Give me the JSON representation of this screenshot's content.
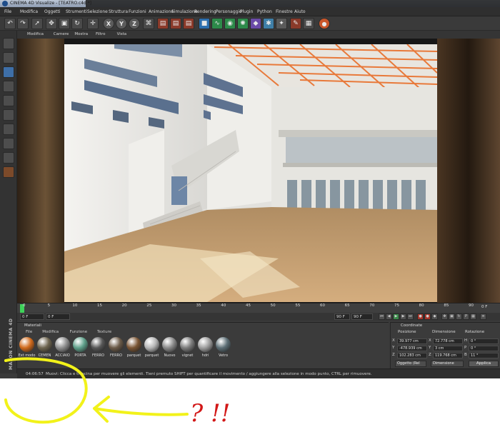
{
  "window": {
    "title": "CINEMA 4D Visualize - [TEATRO.c4d *]"
  },
  "menubar": {
    "items": [
      "File",
      "Modifica",
      "Oggetti",
      "Strumenti",
      "Selezione",
      "Struttura",
      "Funzioni",
      "Animazione",
      "Simulazione",
      "Rendering",
      "Personaggio",
      "Plugin",
      "Python",
      "Finestre",
      "Aiuto"
    ]
  },
  "toolbar": {
    "axis_x": "X",
    "axis_y": "Y",
    "axis_z": "Z"
  },
  "viewport": {
    "menu": [
      "Modifica",
      "Camere",
      "Mostra",
      "Filtro",
      "Vista"
    ]
  },
  "timeline": {
    "ticks": [
      "0",
      "5",
      "10",
      "15",
      "20",
      "25",
      "30",
      "35",
      "40",
      "45",
      "50",
      "55",
      "60",
      "65",
      "70",
      "75",
      "80",
      "85",
      "90"
    ],
    "end_label": "0 F",
    "start_field": "0 F",
    "min_field": "0 F",
    "max_a": "90 F",
    "max_b": "90 F"
  },
  "materials": {
    "title": "Materiali",
    "menu": [
      "File",
      "Modifica",
      "Funzione",
      "Texture"
    ],
    "swatches": [
      {
        "label": "Ext modo",
        "color": "#d06a1c"
      },
      {
        "label": "CEMEN",
        "color": "#6e6550"
      },
      {
        "label": "ACCIAIO",
        "color": "#8f8f8f"
      },
      {
        "label": "PORTA",
        "color": "#5fa08a"
      },
      {
        "label": "FERRO",
        "color": "#575757"
      },
      {
        "label": "FERRO",
        "color": "#6b5a48"
      },
      {
        "label": "parquet",
        "color": "#7a5534"
      },
      {
        "label": "parquet",
        "color": "#b5b5b5"
      },
      {
        "label": "Nuovo",
        "color": "#8a8a8a"
      },
      {
        "label": "vignet",
        "color": "#7c7c7c"
      },
      {
        "label": "hdri",
        "color": "#9e9e9e"
      },
      {
        "label": "Vetro",
        "color": "#5c6e75"
      }
    ]
  },
  "coordinates": {
    "title": "Coordinate",
    "headers": [
      "Posizione",
      "Dimensione",
      "Rotazione"
    ],
    "rows": [
      {
        "axis": "X",
        "pos": "39.977 cm",
        "dim_axis": "X",
        "dim": "72.778 cm",
        "rot_axis": "H",
        "rot": "0 °"
      },
      {
        "axis": "Y",
        "pos": "-478.939 cm",
        "dim_axis": "Y",
        "dim": "3 cm",
        "rot_axis": "P",
        "rot": "0 °"
      },
      {
        "axis": "Z",
        "pos": "102.283 cm",
        "dim_axis": "Z",
        "dim": "119.768 cm",
        "rot_axis": "B",
        "rot": "11 °"
      }
    ],
    "mode": "Oggetto (Rel",
    "size_mode": "Dimensione",
    "apply": "Applica"
  },
  "status": {
    "time": "04:06:57",
    "message": "Muovi: Clicca e trascina per muovere gli elementi. Tieni premuto SHIFT per quantificare il movimento / aggiungere alla selezione in modo punto, CTRL per rimuovere."
  },
  "brand": {
    "text": "MAXON CINEMA 4D"
  },
  "annotation": {
    "handwriting": "? !!"
  }
}
